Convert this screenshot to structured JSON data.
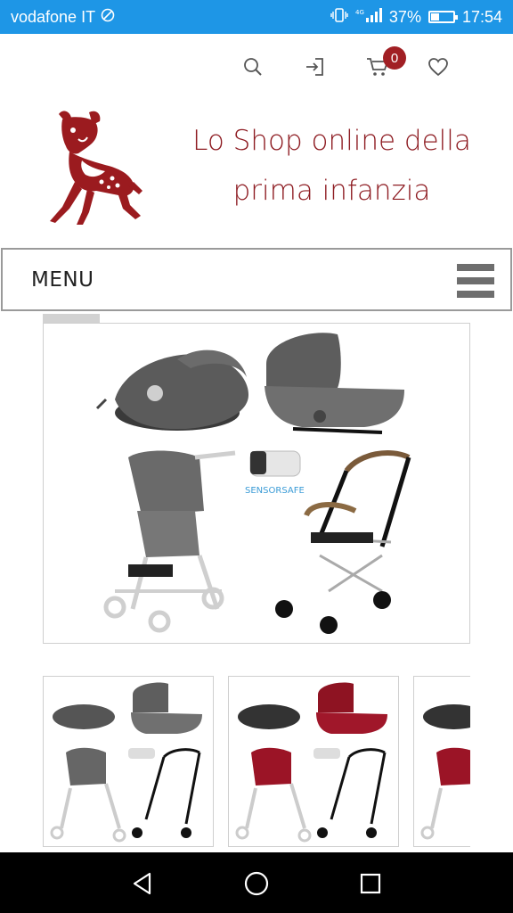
{
  "status_bar": {
    "carrier": "vodafone IT",
    "network": "4G",
    "battery_percent": "37%",
    "battery_level": 0.37,
    "time": "17:54"
  },
  "header": {
    "icons": [
      "search-icon",
      "login-icon",
      "cart-icon",
      "heart-icon"
    ],
    "cart_count": "0"
  },
  "brand": {
    "tagline_line1": "Lo Shop online della",
    "tagline_line2": "prima infanzia",
    "color": "#8e1c22"
  },
  "menu": {
    "label": "MENU"
  },
  "gallery": {
    "main_image": {
      "badge_text": "SENSORSAFE"
    },
    "thumbnails": [
      {
        "variant": "grey"
      },
      {
        "variant": "red"
      },
      {
        "variant": "red"
      }
    ]
  },
  "colors": {
    "status_bar": "#1e96e6",
    "accent": "#a11f24",
    "nav_bar": "#000000"
  }
}
